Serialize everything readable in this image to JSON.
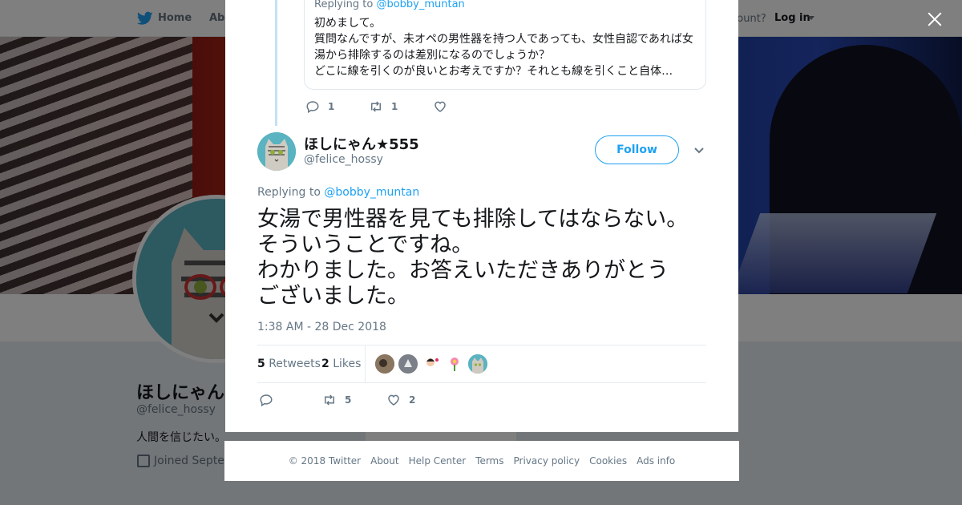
{
  "topbar": {
    "home": "Home",
    "about": "Abo",
    "account_question": "ccount?",
    "login": "Log in"
  },
  "profile": {
    "name": "ほしにゃん",
    "handle": "@felice_hossy",
    "bio": "人間を信じたい。",
    "joined": "Joined Septen"
  },
  "quoted_reply": {
    "replying_prefix": "Replying to",
    "replying_handle": "@bobby_muntan",
    "lines": [
      "初めまして。",
      "質問なんですが、未オペの男性器を持つ人であっても、女性自認であれば女",
      "湯から排除するのは差別になるのでしょうか？",
      "どこに線を引くのが良いとお考えですか？それとも線を引くこと自体…"
    ],
    "reply_count": "1",
    "retweet_count": "1"
  },
  "tweet": {
    "author_name": "ほしにゃん★555",
    "author_handle": "@felice_hossy",
    "follow_label": "Follow",
    "replying_prefix": "Replying to",
    "replying_handle": "@bobby_muntan",
    "lines": [
      "女湯で男性器を見ても排除してはならない。",
      "そういうことですね。",
      "わかりました。お答えいただきありがとう",
      "ございました。"
    ],
    "timestamp": "1:38 AM - 28 Dec 2018",
    "retweets_count": "5",
    "retweets_label": "Retweets",
    "likes_count": "2",
    "likes_label": "Likes",
    "action_retweet_count": "5",
    "action_like_count": "2"
  },
  "footer": {
    "links": [
      "© 2018 Twitter",
      "About",
      "Help Center",
      "Terms",
      "Privacy policy",
      "Cookies",
      "Ads info"
    ]
  },
  "colors": {
    "accent": "#1da1f2",
    "text_primary": "#14171a",
    "text_secondary": "#657786",
    "thread_line": "#c4e1f5"
  },
  "icons": [
    "twitter-bird-icon",
    "close-icon",
    "reply-icon",
    "retweet-icon",
    "like-icon",
    "chevron-down-icon",
    "calendar-icon"
  ]
}
